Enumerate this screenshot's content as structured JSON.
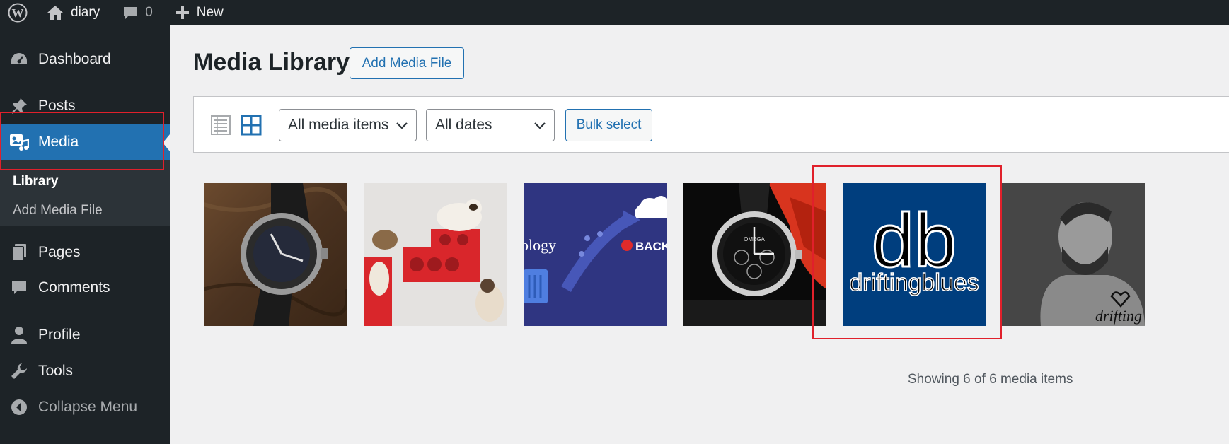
{
  "adminbar": {
    "site_name": "diary",
    "comments_count": "0",
    "new_label": "New"
  },
  "sidebar": {
    "items": [
      {
        "label": "Dashboard",
        "icon": "dashboard-icon"
      },
      {
        "label": "Posts",
        "icon": "pin-icon"
      },
      {
        "label": "Media",
        "icon": "media-icon"
      },
      {
        "label": "Pages",
        "icon": "pages-icon"
      },
      {
        "label": "Comments",
        "icon": "comment-icon"
      },
      {
        "label": "Profile",
        "icon": "user-icon"
      },
      {
        "label": "Tools",
        "icon": "wrench-icon"
      },
      {
        "label": "Collapse Menu",
        "icon": "collapse-icon"
      }
    ],
    "submenu": [
      {
        "label": "Library"
      },
      {
        "label": "Add Media File"
      }
    ]
  },
  "main": {
    "title": "Media Library",
    "add_button": "Add Media File",
    "filters": {
      "media_type": "All media items",
      "dates": "All dates",
      "bulk_select": "Bulk select"
    },
    "thumbnails": [
      {
        "alt": "watch on wood"
      },
      {
        "alt": "cats on red shelves"
      },
      {
        "alt": "synology backup banner",
        "text_1": "ology",
        "text_2": "BACK"
      },
      {
        "alt": "omega speedmaster watch",
        "brand": "OMEGA"
      },
      {
        "alt": "driftingblues logo",
        "text_big": "db",
        "text_small": "driftingblues"
      },
      {
        "alt": "gigachad portrait",
        "text": "drifting"
      }
    ],
    "count_text": "Showing 6 of 6 media items"
  },
  "colors": {
    "admin_bg": "#1d2327",
    "accent": "#2271b1",
    "highlight": "#e0202b",
    "logo_bg": "#003e7e"
  }
}
